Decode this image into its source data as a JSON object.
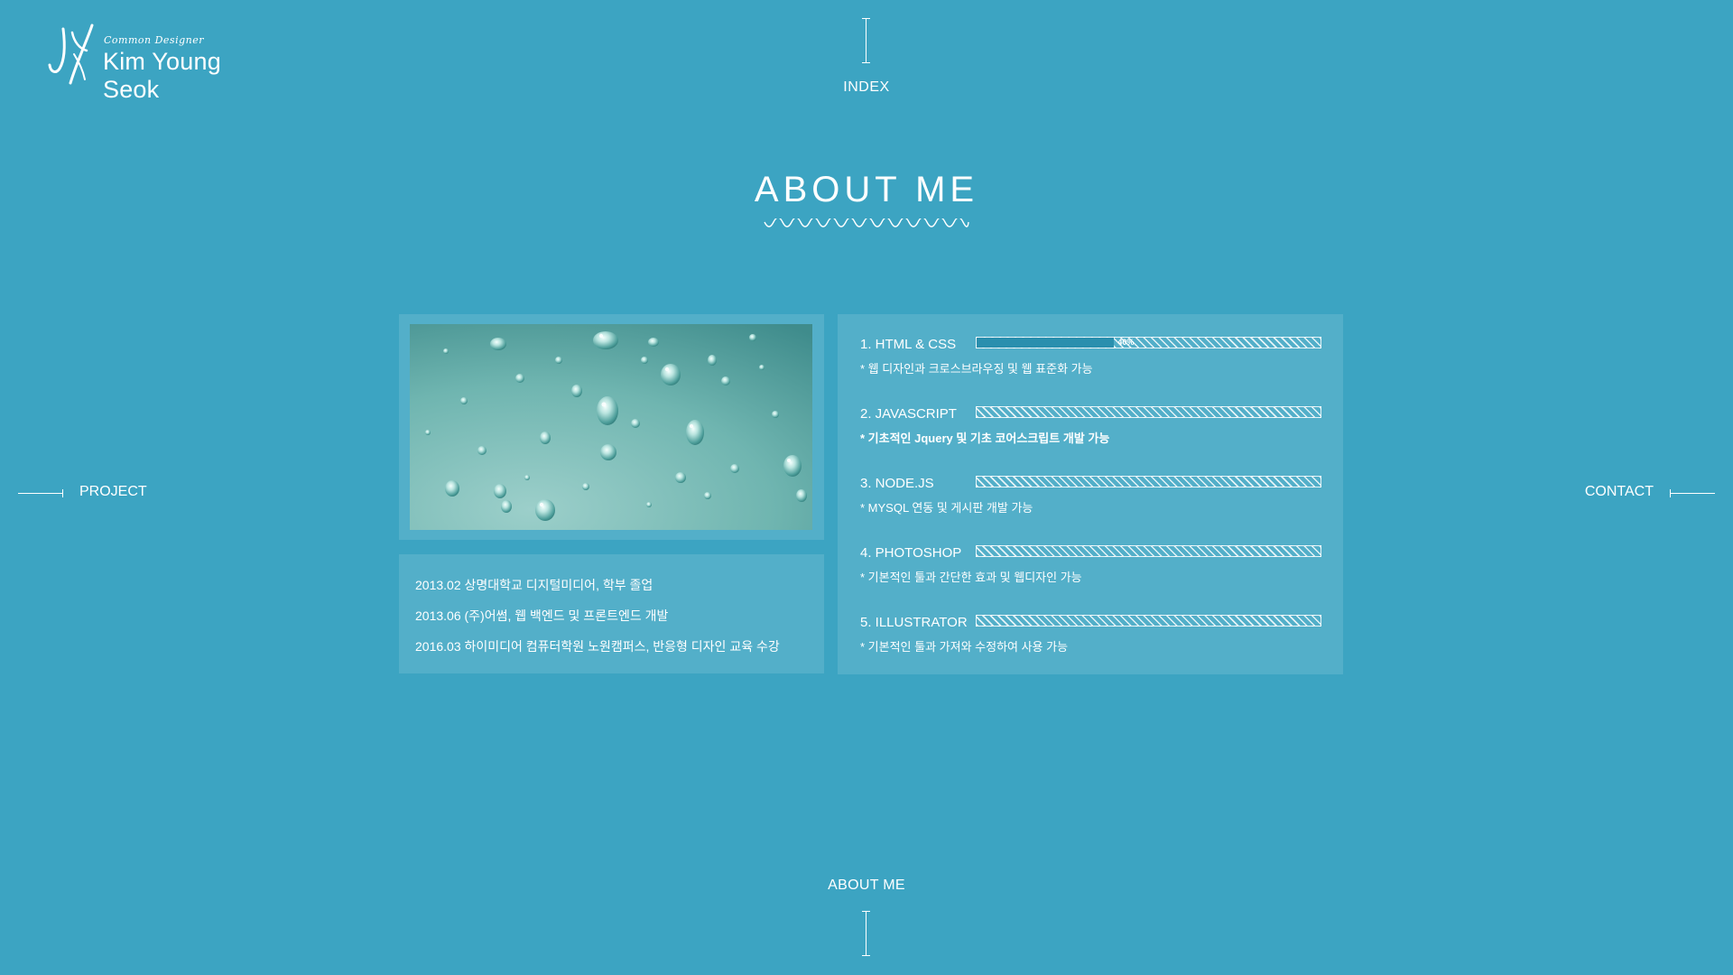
{
  "header": {
    "logo_subtitle": "Common Designer",
    "logo_name": "Kim Young Seok"
  },
  "nav": {
    "top": "INDEX",
    "left": "PROJECT",
    "right": "CONTACT",
    "bottom": "ABOUT ME"
  },
  "section": {
    "title": "ABOUT ME"
  },
  "education": [
    "2013.02 상명대학교 디지털미디어, 학부 졸업",
    "2013.06 (주)어썸, 웹 백엔드 및 프론트엔드 개발",
    "2016.03 하이미디어 컴퓨터학원 노원캠퍼스, 반응형 디자인 교육 수강"
  ],
  "skills": [
    {
      "name": "1. HTML & CSS",
      "level": 0.4,
      "label": "40%",
      "desc": "* 웹 디자인과 크로스브라우징 및 웹 표준화 가능"
    },
    {
      "name": "2. JAVASCRIPT",
      "level": 0,
      "label": "",
      "desc": "* 기초적인 Jquery 및 기초 코어스크립트 개발 가능"
    },
    {
      "name": "3. NODE.JS",
      "level": 0,
      "label": "",
      "desc": "* MYSQL 연동 및 게시판 개발 가능"
    },
    {
      "name": "4. PHOTOSHOP",
      "level": 0,
      "label": "",
      "desc": "* 기본적인 툴과 간단한 효과 및 웹디자인 가능"
    },
    {
      "name": "5. ILLUSTRATOR",
      "level": 0,
      "label": "",
      "desc": "* 기본적인 툴과 가져와 수정하여 사용 가능"
    }
  ],
  "colors": {
    "background": "#3ca4c2",
    "bar_fill": "#2a8fae",
    "text": "#ffffff"
  }
}
